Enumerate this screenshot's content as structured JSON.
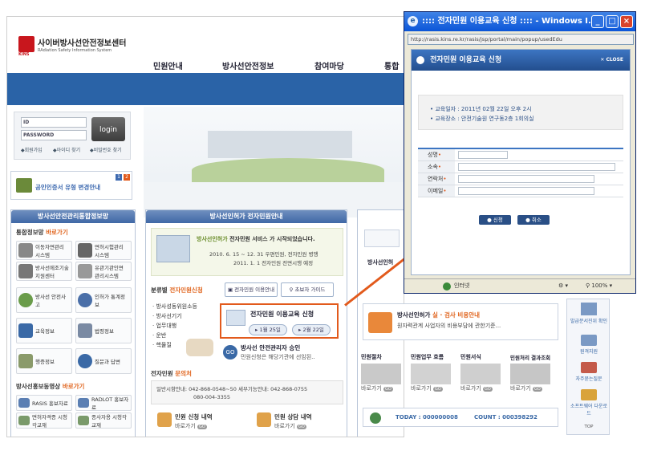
{
  "site": {
    "logo_title": "사이버방사선안전정보센터",
    "logo_sub": "RAdiation Safety Information System",
    "logo_kins": "KINS",
    "nav": [
      "민원안내",
      "방사선안전정보",
      "참여마당",
      "통합"
    ],
    "login": {
      "id_label": "ID",
      "pw_label": "PASSWORD",
      "button": "login",
      "links": [
        "회원가입",
        "아이디 찾기",
        "비밀번호 찾기"
      ]
    },
    "cert_banner": "공인인증서 유형 변경안내",
    "cert_pages": [
      "1",
      "2"
    ],
    "left_panel": {
      "title": "방사선안전관리통합정보망",
      "shortcut_title_a": "통합정보망",
      "shortcut_title_b": "바로가기",
      "systems": [
        {
          "label": "이동자면관리 시스템"
        },
        {
          "label": "면허시험관리 시스템"
        },
        {
          "label": "방사선에조기술 지원센터"
        },
        {
          "label": "유관기관인면 관리시스템"
        }
      ],
      "menu": [
        {
          "label": "방사선 안전사고"
        },
        {
          "label": "인허가 통계정보"
        },
        {
          "label": "교육정보"
        },
        {
          "label": "법령정보"
        },
        {
          "label": "행증정보"
        },
        {
          "label": "질문과 답변"
        }
      ],
      "video_title_a": "방사선홍보동영상",
      "video_title_b": "바로가기",
      "videos": [
        {
          "label": "RASIS 홍보자료"
        },
        {
          "label": "RADLOT 홍보자료"
        },
        {
          "label": "면허자격증 시청각교재"
        },
        {
          "label": "종사자용 시청각교재"
        }
      ]
    },
    "center_panel": {
      "title": "방사선인허가 전자민원안내",
      "announce_title_a": "방사선인허가",
      "announce_title_b": "전자민원 서비스 가 시작되었습니다.",
      "announce_line1": "2010. 6. 15 ~ 12. 31 우편민원, 전자민원 병행",
      "announce_line2": "2011. 1. 1 전자민원 전면시행 예정",
      "guide_label": "분류별",
      "guide_label_b": "전자민원신청",
      "btn_edu": "전자민원 이용안내",
      "btn_guide": "초보자 가이드",
      "categories": [
        "방사성동위원소등",
        "방사선기기",
        "업무대행",
        "운반",
        "핵물질"
      ],
      "edu_title": "전자민원 이용교육 신청",
      "edu_dates": [
        "1월 25일",
        "2월 22일"
      ],
      "approval_title": "방사선 안전관리자 승인",
      "approval_text": "민원신청은 해당기관에 선임된..",
      "contact_title_a": "전자민원",
      "contact_title_b": "문의처",
      "contact_line1": "일반시항안내: 042-868-0548~50  세부기능안내: 042-868-0755",
      "contact_line2": "080-004-3355",
      "bottom_links": [
        {
          "title": "민원 신청 내역",
          "link": "바로가기"
        },
        {
          "title": "민원 상담 내역",
          "link": "바로가기"
        }
      ],
      "go_badge": "GO"
    },
    "right_panel": {
      "title_frag": "방사선인허",
      "promo_title_a": "방사선인허가",
      "promo_title_b": "실 · 검사 비용안내",
      "promo_text": "원자력관계 사업자의 비용부담에 관한기준...",
      "tiles": [
        {
          "label": "민원절차",
          "link": "바로가기"
        },
        {
          "label": "민원업무 흐름",
          "link": "바로가기"
        },
        {
          "label": "민원서식",
          "link": "바로가기"
        },
        {
          "label": "민원처리 결과조회",
          "link": "바로가기"
        }
      ],
      "today_label": "TODAY : 000000008",
      "count_label": "COUNT : 000398292"
    },
    "quick_menu": [
      {
        "label": "발급문서진위 확인"
      },
      {
        "label": "원격지원"
      },
      {
        "label": "자주묻는질문"
      },
      {
        "label": "소프트웨어 다운로드"
      }
    ],
    "quick_top": "TOP"
  },
  "popup": {
    "window_title": ":::: 전자민원 이용교육 신청 :::: - Windows I...",
    "address": "http://rasis.kins.re.kr/rasis/jsp/portal/main/popup/usedEdu",
    "header": "전자민원 이용교육 신청",
    "close": "CLOSE",
    "info": [
      "교육일자 : 2011년 02월 22일 오후 2시",
      "교육장소 : 안전기술원 연구동2층 1회의실"
    ],
    "fields": [
      {
        "label": "성명"
      },
      {
        "label": "소속"
      },
      {
        "label": "연락처"
      },
      {
        "label": "이메일"
      }
    ],
    "submit": "신청",
    "cancel": "취소",
    "status_zone": "인터넷",
    "zoom": "100%"
  },
  "colors": {
    "accent": "#2a63a7",
    "highlight": "#e25a1c",
    "popup_title": "#0b55d8"
  }
}
